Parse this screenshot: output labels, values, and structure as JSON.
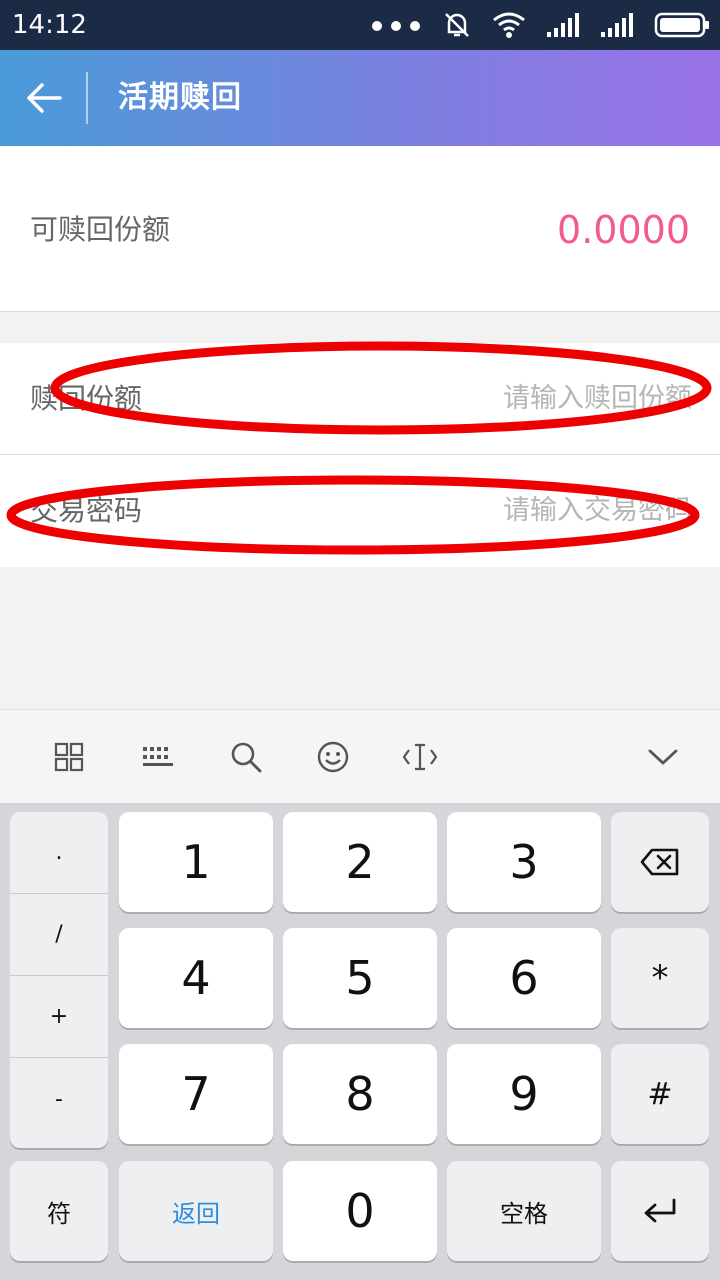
{
  "status_bar": {
    "time": "14:12"
  },
  "app_bar": {
    "title": "活期赎回"
  },
  "balance": {
    "label": "可赎回份额",
    "value": "0.0000"
  },
  "form": {
    "redeem": {
      "label": "赎回份额",
      "placeholder": "请输入赎回份额"
    },
    "password": {
      "label": "交易密码",
      "placeholder": "请输入交易密码"
    }
  },
  "keyboard": {
    "symbols": [
      ".",
      "/",
      "+",
      "-"
    ],
    "digits": [
      "1",
      "2",
      "3",
      "4",
      "5",
      "6",
      "7",
      "8",
      "9",
      "0"
    ],
    "star": "*",
    "hash": "#",
    "fu": "符",
    "back": "返回",
    "space": "空格"
  },
  "colors": {
    "accent_value": "#f25b8c",
    "back_key_text": "#2d8ee0",
    "annotation": "#ee0000"
  }
}
